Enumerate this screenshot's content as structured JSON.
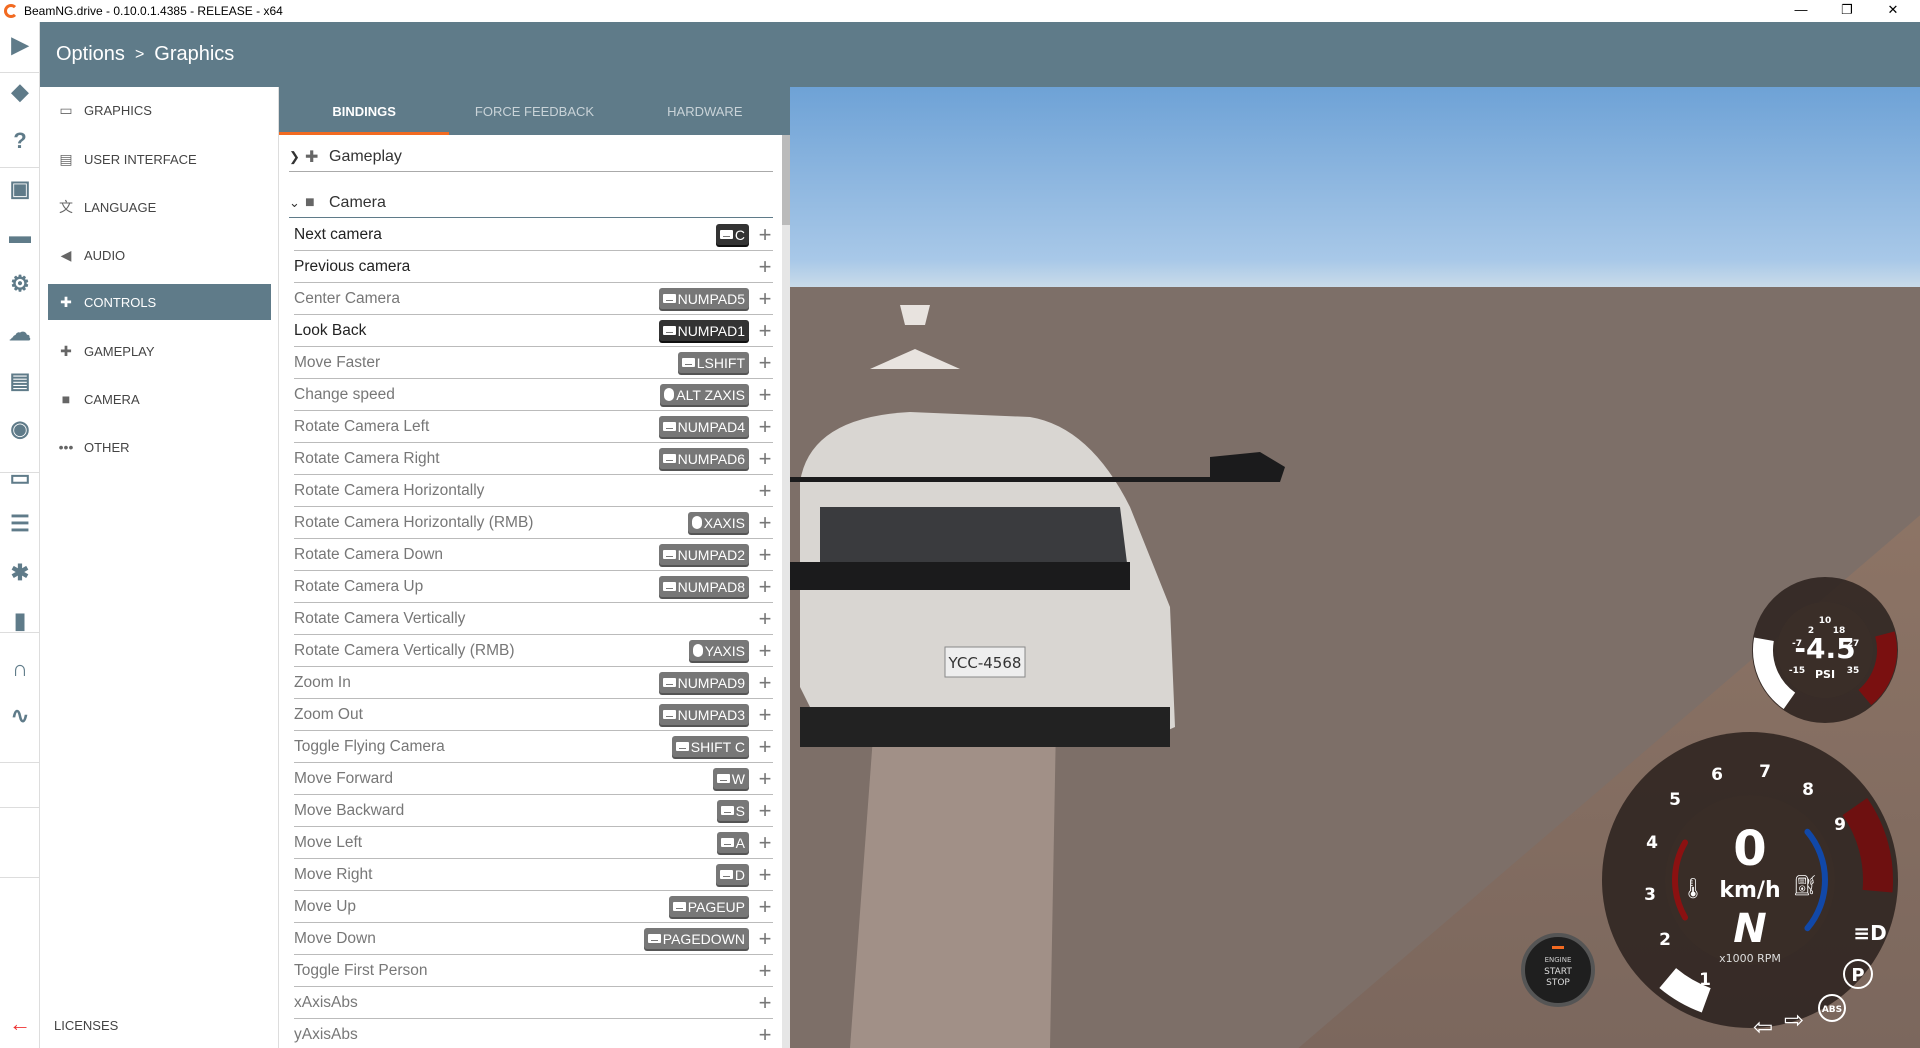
{
  "window": {
    "title": "BeamNG.drive - 0.10.0.1.4385 - RELEASE - x64",
    "minimize": "—",
    "restore": "❐",
    "close": "✕"
  },
  "header": {
    "crumb1": "Options",
    "sep": ">",
    "crumb2": "Graphics"
  },
  "strip_icons": [
    "play-icon",
    "layers-icon",
    "help-icon",
    "mission-icon",
    "car-icon",
    "settings-icon",
    "cloud-icon",
    "film-icon",
    "camera-icon",
    "ui-apps-icon",
    "sliders-icon",
    "bug-icon",
    "stats-icon",
    "headphones-icon",
    "path-icon"
  ],
  "menu": {
    "items": [
      {
        "label": "GRAPHICS",
        "icon": "monitor-icon"
      },
      {
        "label": "USER INTERFACE",
        "icon": "layout-icon"
      },
      {
        "label": "LANGUAGE",
        "icon": "translate-icon"
      },
      {
        "label": "AUDIO",
        "icon": "speaker-icon"
      },
      {
        "label": "CONTROLS",
        "icon": "gamepad-icon",
        "selected": true
      },
      {
        "label": "GAMEPLAY",
        "icon": "puzzle-icon"
      },
      {
        "label": "CAMERA",
        "icon": "video-icon"
      },
      {
        "label": "OTHER",
        "icon": "more-icon"
      }
    ],
    "licenses": "LICENSES"
  },
  "tabs": [
    {
      "label": "BINDINGS",
      "active": true
    },
    {
      "label": "FORCE FEEDBACK"
    },
    {
      "label": "HARDWARE"
    }
  ],
  "groups": {
    "gameplay": "Gameplay",
    "camera": "Camera"
  },
  "rows": [
    {
      "label": "Next camera",
      "key": "C",
      "dev": "kb",
      "dark": true,
      "bold": true
    },
    {
      "label": "Previous camera",
      "key": "",
      "dark": true
    },
    {
      "label": "Center Camera",
      "key": "NUMPAD5",
      "dev": "kb"
    },
    {
      "label": "Look Back",
      "key": "NUMPAD1",
      "dev": "kb",
      "dark": true,
      "bold": true
    },
    {
      "label": "Move Faster",
      "key": "LSHIFT",
      "dev": "kb"
    },
    {
      "label": "Change speed",
      "key": "ALT ZAXIS",
      "dev": "mouse"
    },
    {
      "label": "Rotate Camera Left",
      "key": "NUMPAD4",
      "dev": "kb"
    },
    {
      "label": "Rotate Camera Right",
      "key": "NUMPAD6",
      "dev": "kb"
    },
    {
      "label": "Rotate Camera Horizontally",
      "key": ""
    },
    {
      "label": "Rotate Camera Horizontally (RMB)",
      "key": "XAXIS",
      "dev": "mouse"
    },
    {
      "label": "Rotate Camera Down",
      "key": "NUMPAD2",
      "dev": "kb"
    },
    {
      "label": "Rotate Camera Up",
      "key": "NUMPAD8",
      "dev": "kb"
    },
    {
      "label": "Rotate Camera Vertically",
      "key": ""
    },
    {
      "label": "Rotate Camera Vertically (RMB)",
      "key": "YAXIS",
      "dev": "mouse"
    },
    {
      "label": "Zoom In",
      "key": "NUMPAD9",
      "dev": "kb"
    },
    {
      "label": "Zoom Out",
      "key": "NUMPAD3",
      "dev": "kb"
    },
    {
      "label": "Toggle Flying Camera",
      "key": "SHIFT C",
      "dev": "kb"
    },
    {
      "label": "Move Forward",
      "key": "W",
      "dev": "kb"
    },
    {
      "label": "Move Backward",
      "key": "S",
      "dev": "kb"
    },
    {
      "label": "Move Left",
      "key": "A",
      "dev": "kb"
    },
    {
      "label": "Move Right",
      "key": "D",
      "dev": "kb"
    },
    {
      "label": "Move Up",
      "key": "PAGEUP",
      "dev": "kb"
    },
    {
      "label": "Move Down",
      "key": "PAGEDOWN",
      "dev": "kb"
    },
    {
      "label": "Toggle First Person",
      "key": ""
    },
    {
      "label": "xAxisAbs",
      "key": ""
    },
    {
      "label": "yAxisAbs",
      "key": ""
    }
  ],
  "plus": "+",
  "hud": {
    "boost": {
      "value": "-4.5",
      "unit": "PSI",
      "ticks": [
        "-15",
        "-7",
        "2",
        "10",
        "18",
        "27",
        "35"
      ]
    },
    "speed": {
      "value": "0",
      "unit": "km/h",
      "gear": "N",
      "rpm_label": "x1000 RPM",
      "ticks": [
        "1",
        "2",
        "3",
        "4",
        "5",
        "6",
        "7",
        "8",
        "9"
      ]
    },
    "engine": {
      "l1": "ENGINE",
      "l2": "START",
      "l3": "STOP"
    },
    "abs": "ABS",
    "park": "P",
    "plate": "YCC-4568"
  },
  "colors": {
    "accent": "#5f7b89",
    "tab_underline": "#f26a21"
  }
}
